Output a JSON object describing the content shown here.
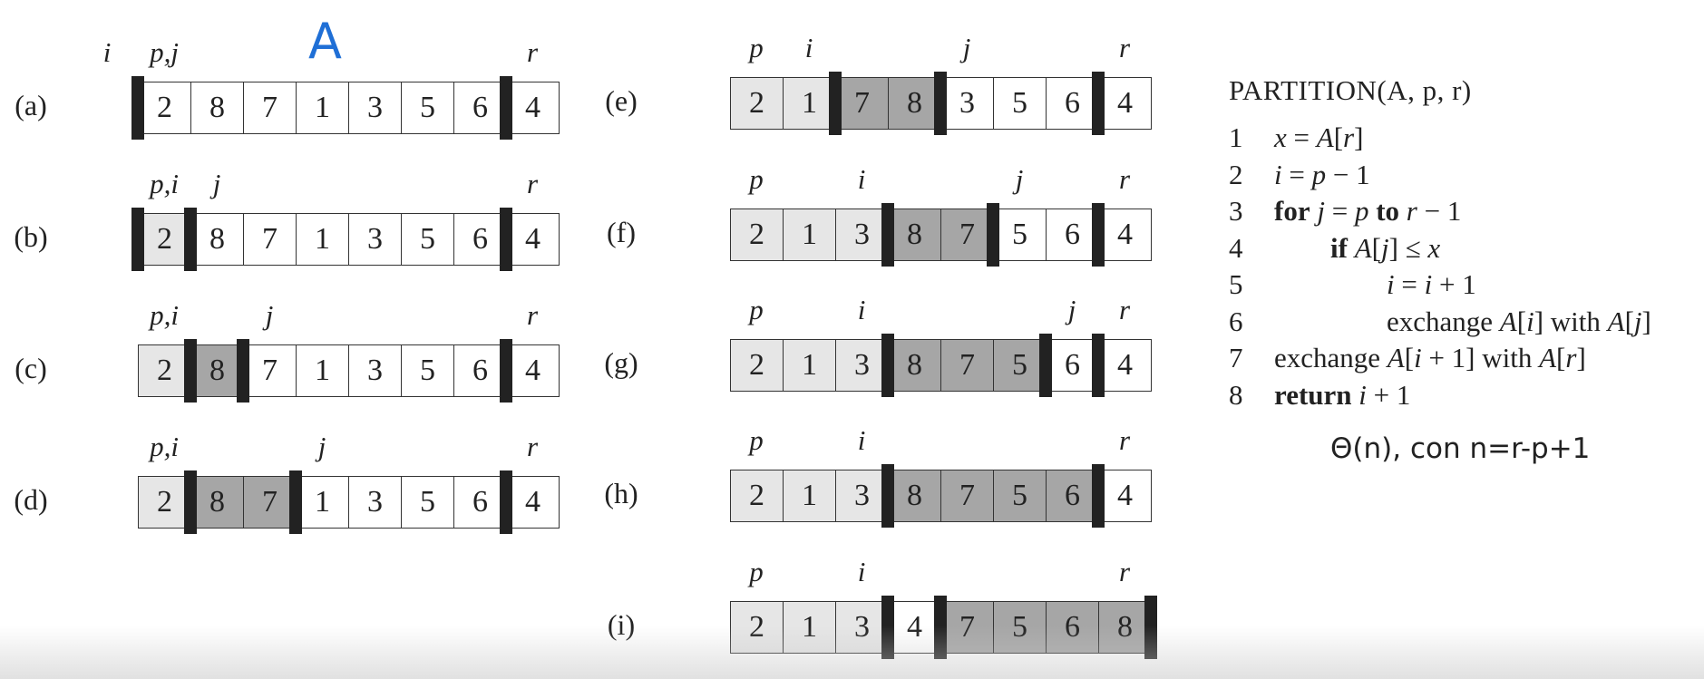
{
  "handwritten_label": "A",
  "partition_title": "PARTITION(A, p, r)",
  "algorithm_lines": [
    {
      "num": "1",
      "indent": 0,
      "html": "<i>x</i> = <i>A</i>[<i>r</i>]"
    },
    {
      "num": "2",
      "indent": 0,
      "html": "<i>i</i> = <i>p</i> &minus; 1"
    },
    {
      "num": "3",
      "indent": 0,
      "html": "<b>for</b> <i>j</i> = <i>p</i> <b>to</b> <i>r</i> &minus; 1"
    },
    {
      "num": "4",
      "indent": 1,
      "html": "<b>if</b> <i>A</i>[<i>j</i>] &le; <i>x</i>"
    },
    {
      "num": "5",
      "indent": 2,
      "html": "<i>i</i> = <i>i</i> + 1"
    },
    {
      "num": "6",
      "indent": 2,
      "html": "exchange <i>A</i>[<i>i</i>] with <i>A</i>[<i>j</i>]"
    },
    {
      "num": "7",
      "indent": 0,
      "html": "exchange <i>A</i>[<i>i</i> + 1] with <i>A</i>[<i>r</i>]"
    },
    {
      "num": "8",
      "indent": 0,
      "html": "<b>return</b> <i>i</i> + 1"
    }
  ],
  "complexity_text": "Θ(n), con n=r-p+1",
  "panels": [
    {
      "label": "(a)",
      "values": [
        "2",
        "8",
        "7",
        "1",
        "3",
        "5",
        "6",
        "4"
      ],
      "shades": [
        "w",
        "w",
        "w",
        "w",
        "w",
        "w",
        "w",
        "w"
      ],
      "bars": [
        0,
        7
      ],
      "indices": [
        {
          "text": "i",
          "pos": -1
        },
        {
          "text": "p,j",
          "pos": 0
        },
        {
          "text": "r",
          "pos": 7
        }
      ]
    },
    {
      "label": "(b)",
      "values": [
        "2",
        "8",
        "7",
        "1",
        "3",
        "5",
        "6",
        "4"
      ],
      "shades": [
        "l",
        "w",
        "w",
        "w",
        "w",
        "w",
        "w",
        "w"
      ],
      "bars": [
        0,
        1,
        7
      ],
      "indices": [
        {
          "text": "p,i",
          "pos": 0
        },
        {
          "text": "j",
          "pos": 1
        },
        {
          "text": "r",
          "pos": 7
        }
      ]
    },
    {
      "label": "(c)",
      "values": [
        "2",
        "8",
        "7",
        "1",
        "3",
        "5",
        "6",
        "4"
      ],
      "shades": [
        "l",
        "d",
        "w",
        "w",
        "w",
        "w",
        "w",
        "w"
      ],
      "bars": [
        1,
        2,
        7
      ],
      "indices": [
        {
          "text": "p,i",
          "pos": 0
        },
        {
          "text": "j",
          "pos": 2
        },
        {
          "text": "r",
          "pos": 7
        }
      ]
    },
    {
      "label": "(d)",
      "values": [
        "2",
        "8",
        "7",
        "1",
        "3",
        "5",
        "6",
        "4"
      ],
      "shades": [
        "l",
        "d",
        "d",
        "w",
        "w",
        "w",
        "w",
        "w"
      ],
      "bars": [
        1,
        3,
        7
      ],
      "indices": [
        {
          "text": "p,i",
          "pos": 0
        },
        {
          "text": "j",
          "pos": 3
        },
        {
          "text": "r",
          "pos": 7
        }
      ]
    },
    {
      "label": "(e)",
      "values": [
        "2",
        "1",
        "7",
        "8",
        "3",
        "5",
        "6",
        "4"
      ],
      "shades": [
        "l",
        "l",
        "d",
        "d",
        "w",
        "w",
        "w",
        "w"
      ],
      "bars": [
        2,
        4,
        7
      ],
      "indices": [
        {
          "text": "p",
          "pos": 0
        },
        {
          "text": "i",
          "pos": 1
        },
        {
          "text": "j",
          "pos": 4
        },
        {
          "text": "r",
          "pos": 7
        }
      ]
    },
    {
      "label": "(f)",
      "values": [
        "2",
        "1",
        "3",
        "8",
        "7",
        "5",
        "6",
        "4"
      ],
      "shades": [
        "l",
        "l",
        "l",
        "d",
        "d",
        "w",
        "w",
        "w"
      ],
      "bars": [
        3,
        5,
        7
      ],
      "indices": [
        {
          "text": "p",
          "pos": 0
        },
        {
          "text": "i",
          "pos": 2
        },
        {
          "text": "j",
          "pos": 5
        },
        {
          "text": "r",
          "pos": 7
        }
      ]
    },
    {
      "label": "(g)",
      "values": [
        "2",
        "1",
        "3",
        "8",
        "7",
        "5",
        "6",
        "4"
      ],
      "shades": [
        "l",
        "l",
        "l",
        "d",
        "d",
        "d",
        "w",
        "w"
      ],
      "bars": [
        3,
        6,
        7
      ],
      "indices": [
        {
          "text": "p",
          "pos": 0
        },
        {
          "text": "i",
          "pos": 2
        },
        {
          "text": "j",
          "pos": 6
        },
        {
          "text": "r",
          "pos": 7
        }
      ]
    },
    {
      "label": "(h)",
      "values": [
        "2",
        "1",
        "3",
        "8",
        "7",
        "5",
        "6",
        "4"
      ],
      "shades": [
        "l",
        "l",
        "l",
        "d",
        "d",
        "d",
        "d",
        "w"
      ],
      "bars": [
        3,
        7
      ],
      "indices": [
        {
          "text": "p",
          "pos": 0
        },
        {
          "text": "i",
          "pos": 2
        },
        {
          "text": "r",
          "pos": 7
        }
      ]
    },
    {
      "label": "(i)",
      "values": [
        "2",
        "1",
        "3",
        "4",
        "7",
        "5",
        "6",
        "8"
      ],
      "shades": [
        "l",
        "l",
        "l",
        "w",
        "d",
        "d",
        "d",
        "d"
      ],
      "bars": [
        3,
        4,
        8
      ],
      "indices": [
        {
          "text": "p",
          "pos": 0
        },
        {
          "text": "i",
          "pos": 2
        },
        {
          "text": "r",
          "pos": 7
        }
      ]
    }
  ]
}
